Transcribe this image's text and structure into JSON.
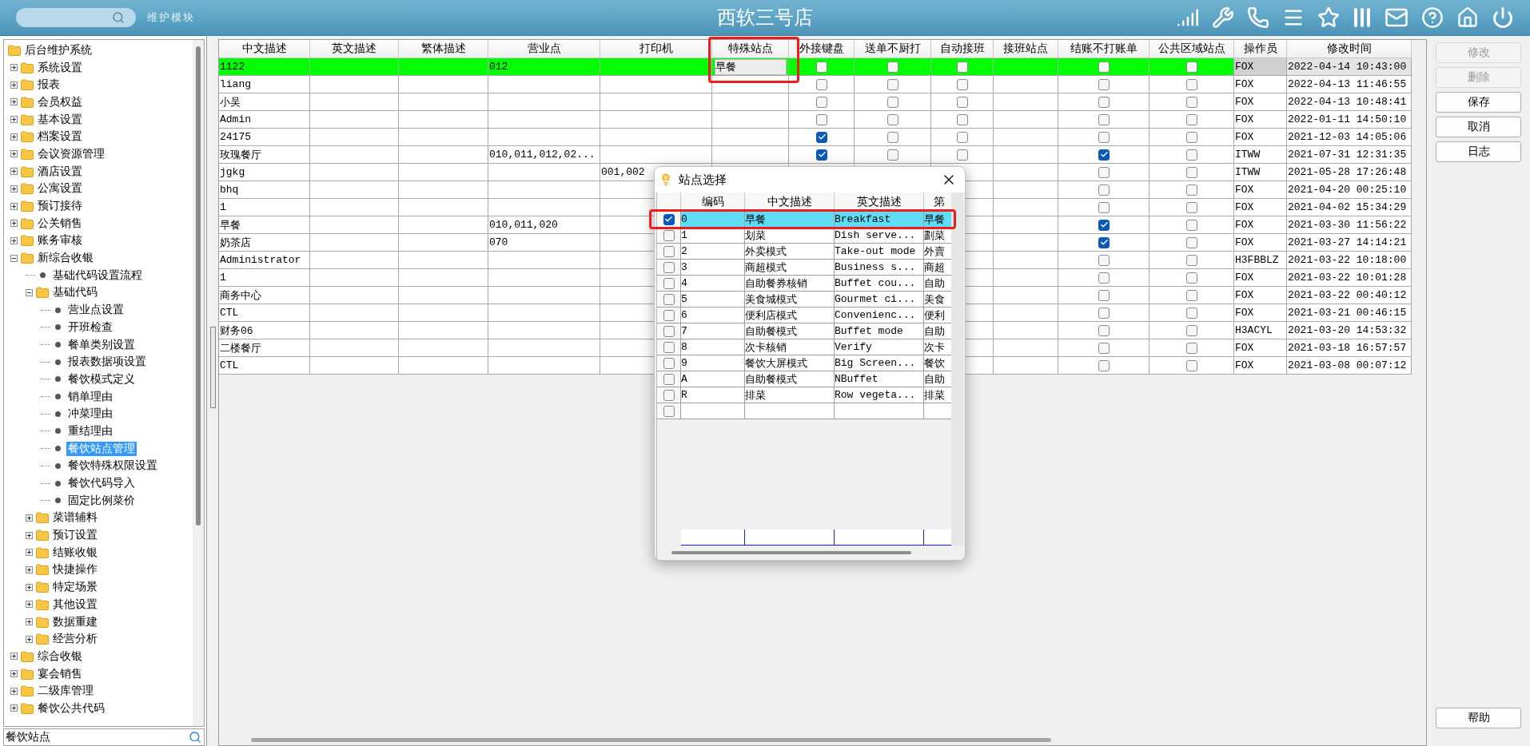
{
  "header": {
    "module_label": "维护模块",
    "title": "西软三号店"
  },
  "tree": {
    "label": "后台维护系统",
    "kind": "folder",
    "selected": false,
    "children": [
      {
        "label": "系统设置",
        "kind": "folder",
        "expanded": false,
        "selected": false
      },
      {
        "label": "报表",
        "kind": "folder",
        "expanded": false,
        "selected": false
      },
      {
        "label": "会员权益",
        "kind": "folder",
        "expanded": false,
        "selected": false
      },
      {
        "label": "基本设置",
        "kind": "folder",
        "expanded": false,
        "selected": false
      },
      {
        "label": "档案设置",
        "kind": "folder",
        "expanded": false,
        "selected": false
      },
      {
        "label": "会议资源管理",
        "kind": "folder",
        "expanded": false,
        "selected": false
      },
      {
        "label": "酒店设置",
        "kind": "folder",
        "expanded": false,
        "selected": false
      },
      {
        "label": "公寓设置",
        "kind": "folder",
        "expanded": false,
        "selected": false
      },
      {
        "label": "预订接待",
        "kind": "folder",
        "expanded": false,
        "selected": false
      },
      {
        "label": "公关销售",
        "kind": "folder",
        "expanded": false,
        "selected": false
      },
      {
        "label": "账务审核",
        "kind": "folder",
        "expanded": false,
        "selected": false
      },
      {
        "label": "新综合收银",
        "kind": "folder",
        "expanded": true,
        "selected": false,
        "children": [
          {
            "label": "基础代码设置流程",
            "kind": "leaf",
            "selected": false
          },
          {
            "label": "基础代码",
            "kind": "folder",
            "expanded": true,
            "selected": false,
            "children": [
              {
                "label": "营业点设置",
                "kind": "leaf",
                "selected": false
              },
              {
                "label": "开班检查",
                "kind": "leaf",
                "selected": false
              },
              {
                "label": "餐单类别设置",
                "kind": "leaf",
                "selected": false
              },
              {
                "label": "报表数据项设置",
                "kind": "leaf",
                "selected": false
              },
              {
                "label": "餐饮模式定义",
                "kind": "leaf",
                "selected": false
              },
              {
                "label": "销单理由",
                "kind": "leaf",
                "selected": false
              },
              {
                "label": "冲菜理由",
                "kind": "leaf",
                "selected": false
              },
              {
                "label": "重结理由",
                "kind": "leaf",
                "selected": false
              },
              {
                "label": "餐饮站点管理",
                "kind": "leaf",
                "selected": true
              },
              {
                "label": "餐饮特殊权限设置",
                "kind": "leaf",
                "selected": false
              },
              {
                "label": "餐饮代码导入",
                "kind": "leaf",
                "selected": false
              },
              {
                "label": "固定比例菜价",
                "kind": "leaf",
                "selected": false
              }
            ]
          },
          {
            "label": "菜谱辅料",
            "kind": "folder",
            "expanded": false,
            "selected": false
          },
          {
            "label": "预订设置",
            "kind": "folder",
            "expanded": false,
            "selected": false
          },
          {
            "label": "结账收银",
            "kind": "folder",
            "expanded": false,
            "selected": false
          },
          {
            "label": "快捷操作",
            "kind": "folder",
            "expanded": false,
            "selected": false
          },
          {
            "label": "特定场景",
            "kind": "folder",
            "expanded": false,
            "selected": false
          },
          {
            "label": "其他设置",
            "kind": "folder",
            "expanded": false,
            "selected": false
          },
          {
            "label": "数据重建",
            "kind": "folder",
            "expanded": false,
            "selected": false
          },
          {
            "label": "经营分析",
            "kind": "folder",
            "expanded": false,
            "selected": false
          }
        ]
      },
      {
        "label": "综合收银",
        "kind": "folder",
        "expanded": false,
        "selected": false
      },
      {
        "label": "宴会销售",
        "kind": "folder",
        "expanded": false,
        "selected": false
      },
      {
        "label": "二级库管理",
        "kind": "folder",
        "expanded": false,
        "selected": false
      },
      {
        "label": "餐饮公共代码",
        "kind": "folder",
        "expanded": false,
        "selected": false
      }
    ]
  },
  "tree_search": {
    "value": "餐饮站点"
  },
  "table": {
    "columns": [
      {
        "label": "中文描述",
        "kind": "text"
      },
      {
        "label": "英文描述",
        "kind": "text"
      },
      {
        "label": "繁体描述",
        "kind": "text"
      },
      {
        "label": "营业点",
        "kind": "text"
      },
      {
        "label": "打印机",
        "kind": "text"
      },
      {
        "label": "特殊站点",
        "kind": "combo"
      },
      {
        "label": "外接键盘",
        "kind": "check"
      },
      {
        "label": "送单不厨打",
        "kind": "check"
      },
      {
        "label": "自动接班",
        "kind": "check"
      },
      {
        "label": "接班站点",
        "kind": "text"
      },
      {
        "label": "结账不打账单",
        "kind": "check"
      },
      {
        "label": "公共区域站点",
        "kind": "check"
      },
      {
        "label": "操作员",
        "kind": "text"
      },
      {
        "label": "修改时间",
        "kind": "text"
      }
    ],
    "rows": [
      {
        "selected": true,
        "cells": [
          "1122",
          null,
          null,
          "012",
          null,
          "早餐",
          false,
          false,
          false,
          null,
          false,
          false,
          "FOX",
          "2022-04-14 10:43:00"
        ]
      },
      {
        "selected": false,
        "cells": [
          "liang",
          null,
          null,
          null,
          null,
          null,
          false,
          false,
          false,
          null,
          false,
          false,
          "FOX",
          "2022-04-13 11:46:55"
        ]
      },
      {
        "selected": false,
        "cells": [
          "小吴",
          null,
          null,
          null,
          null,
          null,
          false,
          false,
          false,
          null,
          false,
          false,
          "FOX",
          "2022-04-13 10:48:41"
        ]
      },
      {
        "selected": false,
        "cells": [
          "Admin",
          null,
          null,
          null,
          null,
          null,
          false,
          false,
          false,
          null,
          false,
          false,
          "FOX",
          "2022-01-11 14:50:10"
        ]
      },
      {
        "selected": false,
        "cells": [
          "24175",
          null,
          null,
          null,
          null,
          null,
          true,
          false,
          false,
          null,
          false,
          false,
          "FOX",
          "2021-12-03 14:05:06"
        ]
      },
      {
        "selected": false,
        "cells": [
          "玫瑰餐厅",
          null,
          null,
          "010,011,012,02...",
          null,
          null,
          true,
          false,
          false,
          null,
          true,
          false,
          "ITWW",
          "2021-07-31 12:31:35"
        ]
      },
      {
        "selected": false,
        "cells": [
          "jgkg",
          null,
          null,
          null,
          "001,002",
          null,
          null,
          null,
          null,
          null,
          false,
          false,
          "ITWW",
          "2021-05-28 17:26:48"
        ]
      },
      {
        "selected": false,
        "cells": [
          "bhq",
          null,
          null,
          null,
          null,
          null,
          null,
          null,
          null,
          null,
          false,
          false,
          "FOX",
          "2021-04-20 00:25:10"
        ]
      },
      {
        "selected": false,
        "cells": [
          "1",
          null,
          null,
          null,
          null,
          null,
          null,
          null,
          null,
          null,
          false,
          false,
          "FOX",
          "2021-04-02 15:34:29"
        ]
      },
      {
        "selected": false,
        "cells": [
          "早餐",
          null,
          null,
          "010,011,020",
          null,
          null,
          null,
          null,
          null,
          null,
          true,
          false,
          "FOX",
          "2021-03-30 11:56:22"
        ]
      },
      {
        "selected": false,
        "cells": [
          "奶茶店",
          null,
          null,
          "070",
          null,
          null,
          null,
          null,
          null,
          null,
          true,
          false,
          "FOX",
          "2021-03-27 14:14:21"
        ]
      },
      {
        "selected": false,
        "cells": [
          "Administrator",
          null,
          null,
          null,
          null,
          null,
          null,
          null,
          null,
          null,
          false,
          false,
          "H3FBBLZ",
          "2021-03-22 10:18:00"
        ]
      },
      {
        "selected": false,
        "cells": [
          "1",
          null,
          null,
          null,
          null,
          null,
          null,
          null,
          null,
          null,
          false,
          false,
          "FOX",
          "2021-03-22 10:01:28"
        ]
      },
      {
        "selected": false,
        "cells": [
          "商务中心",
          null,
          null,
          null,
          null,
          null,
          null,
          null,
          null,
          null,
          false,
          false,
          "FOX",
          "2021-03-22 00:40:12"
        ]
      },
      {
        "selected": false,
        "cells": [
          "CTL",
          null,
          null,
          null,
          null,
          null,
          null,
          null,
          null,
          null,
          false,
          false,
          "FOX",
          "2021-03-21 00:46:15"
        ]
      },
      {
        "selected": false,
        "cells": [
          "财务06",
          null,
          null,
          null,
          null,
          null,
          null,
          null,
          null,
          null,
          false,
          false,
          "H3ACYL",
          "2021-03-20 14:53:32"
        ]
      },
      {
        "selected": false,
        "cells": [
          "二楼餐厅",
          null,
          null,
          null,
          null,
          null,
          null,
          null,
          null,
          null,
          false,
          false,
          "FOX",
          "2021-03-18 16:57:57"
        ]
      },
      {
        "selected": false,
        "cells": [
          "CTL",
          null,
          null,
          null,
          null,
          null,
          null,
          null,
          null,
          null,
          false,
          false,
          "FOX",
          "2021-03-08 00:07:12"
        ]
      }
    ]
  },
  "dialog": {
    "title": "站点选择",
    "columns": [
      "编码",
      "中文描述",
      "英文描述",
      "第"
    ],
    "rows": [
      {
        "checked": true,
        "selected": true,
        "cells": [
          "0",
          "早餐",
          "Breakfast",
          "早餐"
        ]
      },
      {
        "checked": false,
        "selected": false,
        "cells": [
          "1",
          "划菜",
          "Dish serve...",
          "劃菜"
        ]
      },
      {
        "checked": false,
        "selected": false,
        "cells": [
          "2",
          "外卖模式",
          "Take-out mode",
          "外賣"
        ]
      },
      {
        "checked": false,
        "selected": false,
        "cells": [
          "3",
          "商超模式",
          "Business s...",
          "商超"
        ]
      },
      {
        "checked": false,
        "selected": false,
        "cells": [
          "4",
          "自助餐券核销",
          "Buffet cou...",
          "自助"
        ]
      },
      {
        "checked": false,
        "selected": false,
        "cells": [
          "5",
          "美食城模式",
          "Gourmet ci...",
          "美食"
        ]
      },
      {
        "checked": false,
        "selected": false,
        "cells": [
          "6",
          "便利店模式",
          "Convenienc...",
          "便利"
        ]
      },
      {
        "checked": false,
        "selected": false,
        "cells": [
          "7",
          "自助餐模式",
          "Buffet mode",
          "自助"
        ]
      },
      {
        "checked": false,
        "selected": false,
        "cells": [
          "8",
          "次卡核销",
          "Verify",
          "次卡"
        ]
      },
      {
        "checked": false,
        "selected": false,
        "cells": [
          "9",
          "餐饮大屏模式",
          "Big Screen...",
          "餐饮"
        ]
      },
      {
        "checked": false,
        "selected": false,
        "cells": [
          "A",
          "自助餐模式",
          "NBuffet",
          "自助"
        ]
      },
      {
        "checked": false,
        "selected": false,
        "cells": [
          "R",
          "排菜",
          "Row vegeta...",
          "排菜"
        ]
      },
      {
        "checked": false,
        "selected": false
      }
    ]
  },
  "buttons": [
    {
      "label": "修改",
      "disabled": true
    },
    {
      "label": "删除",
      "disabled": true
    },
    {
      "label": "保存",
      "disabled": false
    },
    {
      "label": "取消",
      "disabled": false
    },
    {
      "label": "日志",
      "disabled": false
    }
  ],
  "help_button": {
    "label": "帮助"
  }
}
